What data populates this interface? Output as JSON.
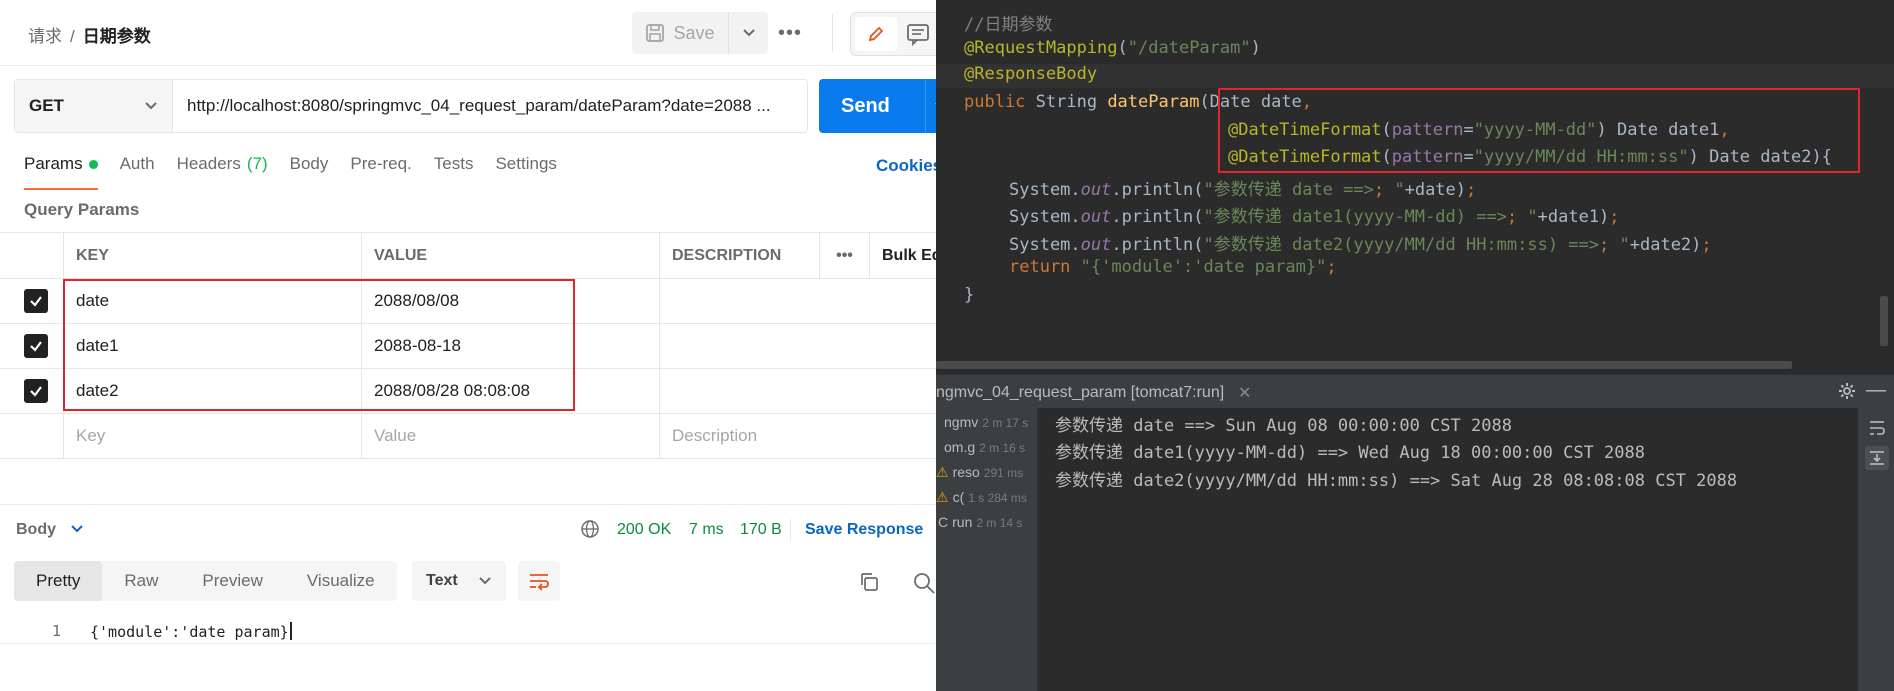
{
  "postman": {
    "breadcrumb": {
      "parent": "请求",
      "separator": "/",
      "current": "日期参数"
    },
    "toolbar": {
      "save_label": "Save",
      "more": "•••"
    },
    "request": {
      "method": "GET",
      "url": "http://localhost:8080/springmvc_04_request_param/dateParam?date=2088 ...",
      "send_label": "Send"
    },
    "tabs": [
      {
        "label": "Params"
      },
      {
        "label": "Auth"
      },
      {
        "label": "Headers",
        "count": "(7)"
      },
      {
        "label": "Body"
      },
      {
        "label": "Pre-req."
      },
      {
        "label": "Tests"
      },
      {
        "label": "Settings"
      }
    ],
    "cookies_label": "Cookies",
    "query_params_title": "Query Params",
    "params_table": {
      "headers": {
        "key": "KEY",
        "value": "VALUE",
        "description": "DESCRIPTION",
        "more": "•••",
        "bulk": "Bulk Edit"
      },
      "rows": [
        {
          "checked": true,
          "key": "date",
          "value": "2088/08/08",
          "description": ""
        },
        {
          "checked": true,
          "key": "date1",
          "value": "2088-08-18",
          "description": ""
        },
        {
          "checked": true,
          "key": "date2",
          "value": "2088/08/28 08:08:08",
          "description": ""
        }
      ],
      "placeholders": {
        "key": "Key",
        "value": "Value",
        "description": "Description"
      }
    },
    "response": {
      "body_label": "Body",
      "status": "200 OK",
      "time": "7 ms",
      "size": "170 B",
      "save_response": "Save Response",
      "formats": [
        "Pretty",
        "Raw",
        "Preview",
        "Visualize"
      ],
      "format_type": "Text",
      "line_number": "1",
      "body_text": "{'module':'date param}"
    }
  },
  "ide": {
    "code_lines": [
      "//日期参数",
      "@RequestMapping(\"/dateParam\")",
      "@ResponseBody",
      "public String dateParam(Date date,",
      "@DateTimeFormat(pattern=\"yyyy-MM-dd\") Date date1,",
      "@DateTimeFormat(pattern=\"yyyy/MM/dd HH:mm:ss\") Date date2){",
      "System.out.println(\"参数传递 date ==> \"+date);",
      "System.out.println(\"参数传递 date1(yyyy-MM-dd) ==> \"+date1);",
      "System.out.println(\"参数传递 date2(yyyy/MM/dd HH:mm:ss) ==> \"+date2);",
      "return \"{'module':'date param}\";",
      "}"
    ],
    "run_panel_title": "ngmvc_04_request_param [tomcat7:run]",
    "run_tree": [
      {
        "name": "ngmv",
        "time": "2 m 17 s"
      },
      {
        "name": "om.g",
        "time": "2 m 16 s"
      },
      {
        "name": "reso",
        "time": "291 ms"
      },
      {
        "name": "c(",
        "time": "1 s 284 ms"
      },
      {
        "name": "run",
        "time": "2 m 14 s"
      }
    ],
    "console_lines": [
      "参数传递 date ==> Sun Aug 08 00:00:00 CST 2088",
      "参数传递 date1(yyyy-MM-dd) ==> Wed Aug 18 00:00:00 CST 2088",
      "参数传递 date2(yyyy/MM/dd HH:mm:ss) ==> Sat Aug 28 08:08:08 CST 2088"
    ]
  }
}
